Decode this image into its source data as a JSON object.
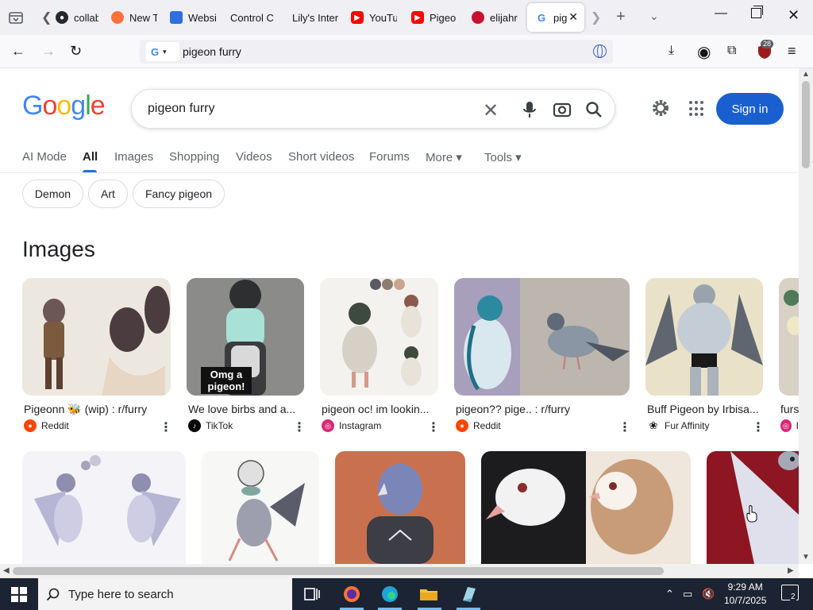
{
  "browser": {
    "tabs": [
      {
        "label": "collab",
        "favicon": "github-icon",
        "color": "#24292f"
      },
      {
        "label": "New T",
        "favicon": "firefox-icon",
        "color": "#ff7139"
      },
      {
        "label": "Websi",
        "favicon": "site-icon",
        "color": "#2f6fdf"
      },
      {
        "label": "Control C",
        "favicon": "blank-icon",
        "color": "#f0f0f4"
      },
      {
        "label": "Lily's Inter",
        "favicon": "blank-icon",
        "color": "#f0f0f4"
      },
      {
        "label": "YouTu",
        "favicon": "youtube-icon",
        "color": "#ff0000"
      },
      {
        "label": "Pigeo",
        "favicon": "youtube-icon",
        "color": "#ff0000"
      },
      {
        "label": "elijahr",
        "favicon": "reddit-icon",
        "color": "#c8102e"
      },
      {
        "label": "pig",
        "favicon": "google-icon",
        "color": "#4285f4",
        "active": true
      }
    ],
    "url_text": "pigeon furry",
    "extension_badge": "28"
  },
  "google": {
    "logo_letters": [
      {
        "ch": "G",
        "color": "#4285f4"
      },
      {
        "ch": "o",
        "color": "#ea4335"
      },
      {
        "ch": "o",
        "color": "#fbbc05"
      },
      {
        "ch": "g",
        "color": "#4285f4"
      },
      {
        "ch": "l",
        "color": "#34a853"
      },
      {
        "ch": "e",
        "color": "#ea4335"
      }
    ],
    "search_query": "pigeon furry",
    "sign_in": "Sign in",
    "tabs": [
      "AI Mode",
      "All",
      "Images",
      "Shopping",
      "Videos",
      "Short videos",
      "Forums",
      "More ▾",
      "Tools ▾"
    ],
    "chips": [
      "Demon",
      "Art",
      "Fancy pigeon"
    ],
    "images_heading": "Images",
    "image_results_row1": [
      {
        "title": "Pigeonn 🐝 (wip) : r/furry",
        "source": "Reddit",
        "source_icon": "reddit-icon"
      },
      {
        "title": "We love birbs and a...",
        "source": "TikTok",
        "source_icon": "tiktok-icon",
        "overlay": "Omg a pigeon!"
      },
      {
        "title": "pigeon oc! im lookin...",
        "source": "Instagram",
        "source_icon": "instagram-icon"
      },
      {
        "title": "pigeon?? pige.. : r/furry",
        "source": "Reddit",
        "source_icon": "reddit-icon"
      },
      {
        "title": "Buff Pigeon by Irbisa...",
        "source": "Fur Affinity",
        "source_icon": "paw-icon"
      },
      {
        "title": "furs",
        "source": "I",
        "source_icon": "instagram-icon"
      }
    ]
  },
  "taskbar": {
    "search_placeholder": "Type here to search",
    "time": "9:29 AM",
    "date": "10/7/2025",
    "notification_count": "2"
  },
  "colors": {
    "accent": "#1a73e8",
    "signin": "#1a5fd0",
    "taskbar": "#1c2333"
  }
}
